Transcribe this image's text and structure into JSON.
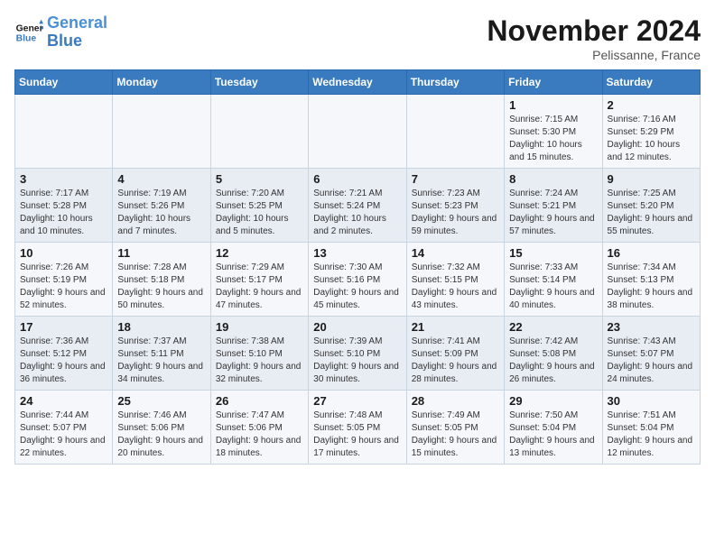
{
  "header": {
    "logo_general": "General",
    "logo_blue": "Blue",
    "month_title": "November 2024",
    "subtitle": "Pelissanne, France"
  },
  "calendar": {
    "weekdays": [
      "Sunday",
      "Monday",
      "Tuesday",
      "Wednesday",
      "Thursday",
      "Friday",
      "Saturday"
    ],
    "weeks": [
      [
        {
          "day": "",
          "info": ""
        },
        {
          "day": "",
          "info": ""
        },
        {
          "day": "",
          "info": ""
        },
        {
          "day": "",
          "info": ""
        },
        {
          "day": "",
          "info": ""
        },
        {
          "day": "1",
          "info": "Sunrise: 7:15 AM\nSunset: 5:30 PM\nDaylight: 10 hours and 15 minutes."
        },
        {
          "day": "2",
          "info": "Sunrise: 7:16 AM\nSunset: 5:29 PM\nDaylight: 10 hours and 12 minutes."
        }
      ],
      [
        {
          "day": "3",
          "info": "Sunrise: 7:17 AM\nSunset: 5:28 PM\nDaylight: 10 hours and 10 minutes."
        },
        {
          "day": "4",
          "info": "Sunrise: 7:19 AM\nSunset: 5:26 PM\nDaylight: 10 hours and 7 minutes."
        },
        {
          "day": "5",
          "info": "Sunrise: 7:20 AM\nSunset: 5:25 PM\nDaylight: 10 hours and 5 minutes."
        },
        {
          "day": "6",
          "info": "Sunrise: 7:21 AM\nSunset: 5:24 PM\nDaylight: 10 hours and 2 minutes."
        },
        {
          "day": "7",
          "info": "Sunrise: 7:23 AM\nSunset: 5:23 PM\nDaylight: 9 hours and 59 minutes."
        },
        {
          "day": "8",
          "info": "Sunrise: 7:24 AM\nSunset: 5:21 PM\nDaylight: 9 hours and 57 minutes."
        },
        {
          "day": "9",
          "info": "Sunrise: 7:25 AM\nSunset: 5:20 PM\nDaylight: 9 hours and 55 minutes."
        }
      ],
      [
        {
          "day": "10",
          "info": "Sunrise: 7:26 AM\nSunset: 5:19 PM\nDaylight: 9 hours and 52 minutes."
        },
        {
          "day": "11",
          "info": "Sunrise: 7:28 AM\nSunset: 5:18 PM\nDaylight: 9 hours and 50 minutes."
        },
        {
          "day": "12",
          "info": "Sunrise: 7:29 AM\nSunset: 5:17 PM\nDaylight: 9 hours and 47 minutes."
        },
        {
          "day": "13",
          "info": "Sunrise: 7:30 AM\nSunset: 5:16 PM\nDaylight: 9 hours and 45 minutes."
        },
        {
          "day": "14",
          "info": "Sunrise: 7:32 AM\nSunset: 5:15 PM\nDaylight: 9 hours and 43 minutes."
        },
        {
          "day": "15",
          "info": "Sunrise: 7:33 AM\nSunset: 5:14 PM\nDaylight: 9 hours and 40 minutes."
        },
        {
          "day": "16",
          "info": "Sunrise: 7:34 AM\nSunset: 5:13 PM\nDaylight: 9 hours and 38 minutes."
        }
      ],
      [
        {
          "day": "17",
          "info": "Sunrise: 7:36 AM\nSunset: 5:12 PM\nDaylight: 9 hours and 36 minutes."
        },
        {
          "day": "18",
          "info": "Sunrise: 7:37 AM\nSunset: 5:11 PM\nDaylight: 9 hours and 34 minutes."
        },
        {
          "day": "19",
          "info": "Sunrise: 7:38 AM\nSunset: 5:10 PM\nDaylight: 9 hours and 32 minutes."
        },
        {
          "day": "20",
          "info": "Sunrise: 7:39 AM\nSunset: 5:10 PM\nDaylight: 9 hours and 30 minutes."
        },
        {
          "day": "21",
          "info": "Sunrise: 7:41 AM\nSunset: 5:09 PM\nDaylight: 9 hours and 28 minutes."
        },
        {
          "day": "22",
          "info": "Sunrise: 7:42 AM\nSunset: 5:08 PM\nDaylight: 9 hours and 26 minutes."
        },
        {
          "day": "23",
          "info": "Sunrise: 7:43 AM\nSunset: 5:07 PM\nDaylight: 9 hours and 24 minutes."
        }
      ],
      [
        {
          "day": "24",
          "info": "Sunrise: 7:44 AM\nSunset: 5:07 PM\nDaylight: 9 hours and 22 minutes."
        },
        {
          "day": "25",
          "info": "Sunrise: 7:46 AM\nSunset: 5:06 PM\nDaylight: 9 hours and 20 minutes."
        },
        {
          "day": "26",
          "info": "Sunrise: 7:47 AM\nSunset: 5:06 PM\nDaylight: 9 hours and 18 minutes."
        },
        {
          "day": "27",
          "info": "Sunrise: 7:48 AM\nSunset: 5:05 PM\nDaylight: 9 hours and 17 minutes."
        },
        {
          "day": "28",
          "info": "Sunrise: 7:49 AM\nSunset: 5:05 PM\nDaylight: 9 hours and 15 minutes."
        },
        {
          "day": "29",
          "info": "Sunrise: 7:50 AM\nSunset: 5:04 PM\nDaylight: 9 hours and 13 minutes."
        },
        {
          "day": "30",
          "info": "Sunrise: 7:51 AM\nSunset: 5:04 PM\nDaylight: 9 hours and 12 minutes."
        }
      ]
    ]
  },
  "colors": {
    "header_bg": "#3a7bbf",
    "accent": "#4a90d9"
  }
}
